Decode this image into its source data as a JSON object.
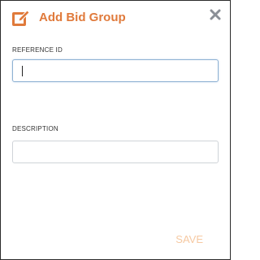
{
  "dialog": {
    "title": "Add Bid Group",
    "title_icon": "edit-icon",
    "close_icon": "close-icon",
    "accent_color": "#e07a3b"
  },
  "fields": {
    "reference_id": {
      "label": "REFERENCE ID",
      "value": ""
    },
    "description": {
      "label": "DESCRIPTION",
      "value": ""
    }
  },
  "actions": {
    "save_label": "SAVE"
  }
}
